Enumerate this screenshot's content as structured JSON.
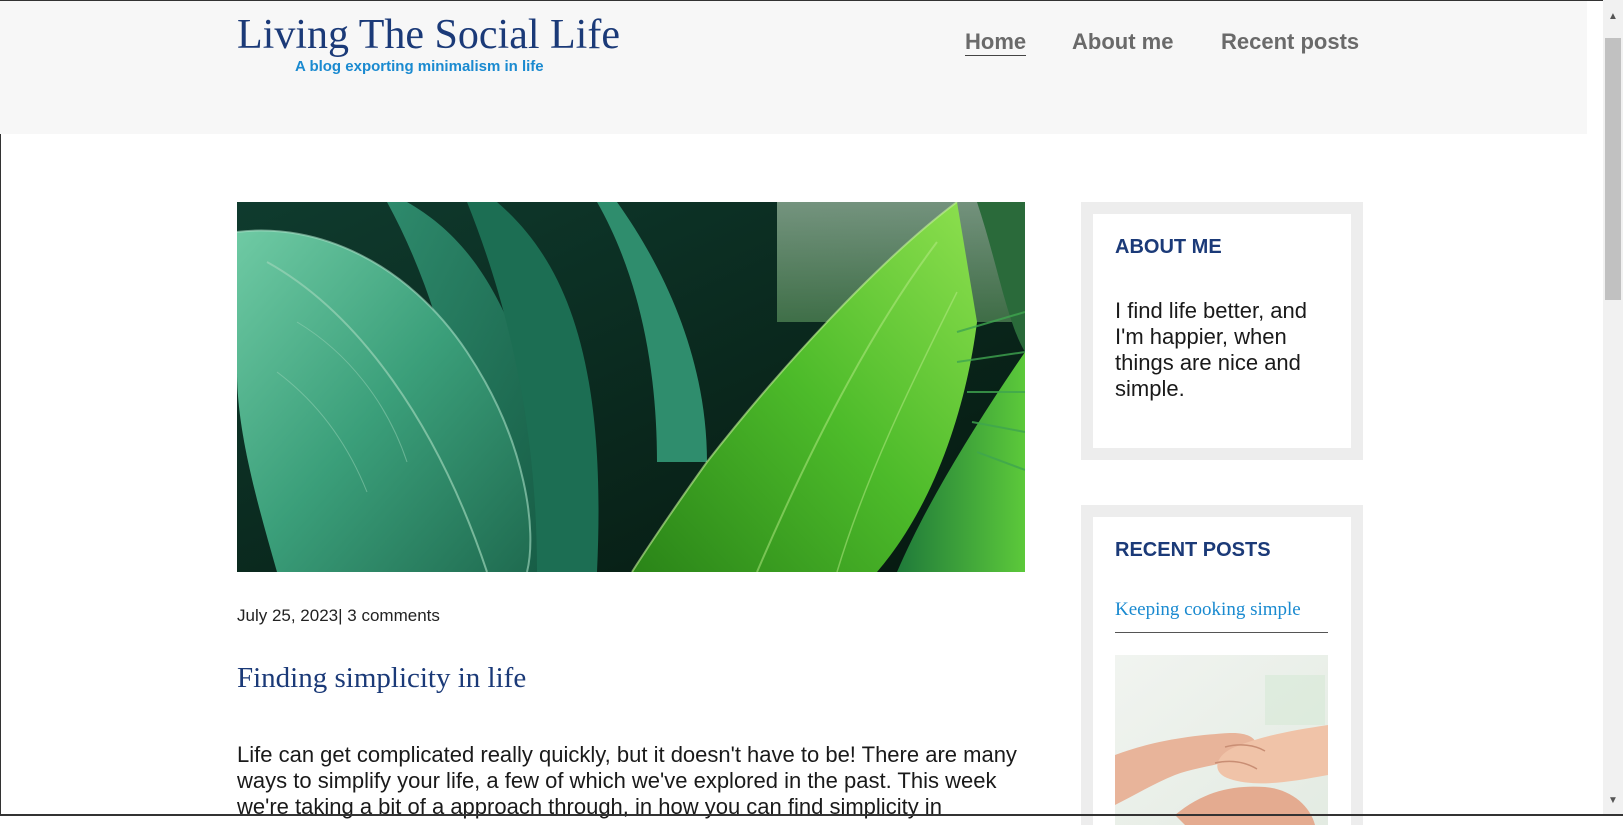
{
  "site": {
    "title": "Living The Social Life",
    "tagline": "A blog exporting minimalism in life"
  },
  "nav": {
    "items": [
      {
        "label": "Home",
        "active": true
      },
      {
        "label": "About me"
      },
      {
        "label": "Recent posts"
      }
    ]
  },
  "post": {
    "date": "July 25, 2023",
    "separator": "|",
    "comments": "3 comments",
    "title": "Finding simplicity in life",
    "body": "Life can get complicated really quickly, but it doesn't have to be! There are many ways to simplify your life, a few of which we've explored in the past. This week we're taking a bit of a approach through, in how you can find simplicity in",
    "hero_image": "green-leaves-photo"
  },
  "sidebar": {
    "about": {
      "title": "ABOUT ME",
      "text": "I find life better, and I'm happier, when things are nice and simple."
    },
    "recent": {
      "title": "RECENT POSTS",
      "posts": [
        {
          "label": "Keeping cooking simple",
          "image": "holding-hands-photo"
        }
      ]
    }
  },
  "colors": {
    "brand_blue": "#1b3a78",
    "link_blue": "#1a8ad0",
    "header_bg": "#f7f7f7",
    "widget_frame": "#ededed",
    "nav_gray": "#6a6a6a"
  }
}
